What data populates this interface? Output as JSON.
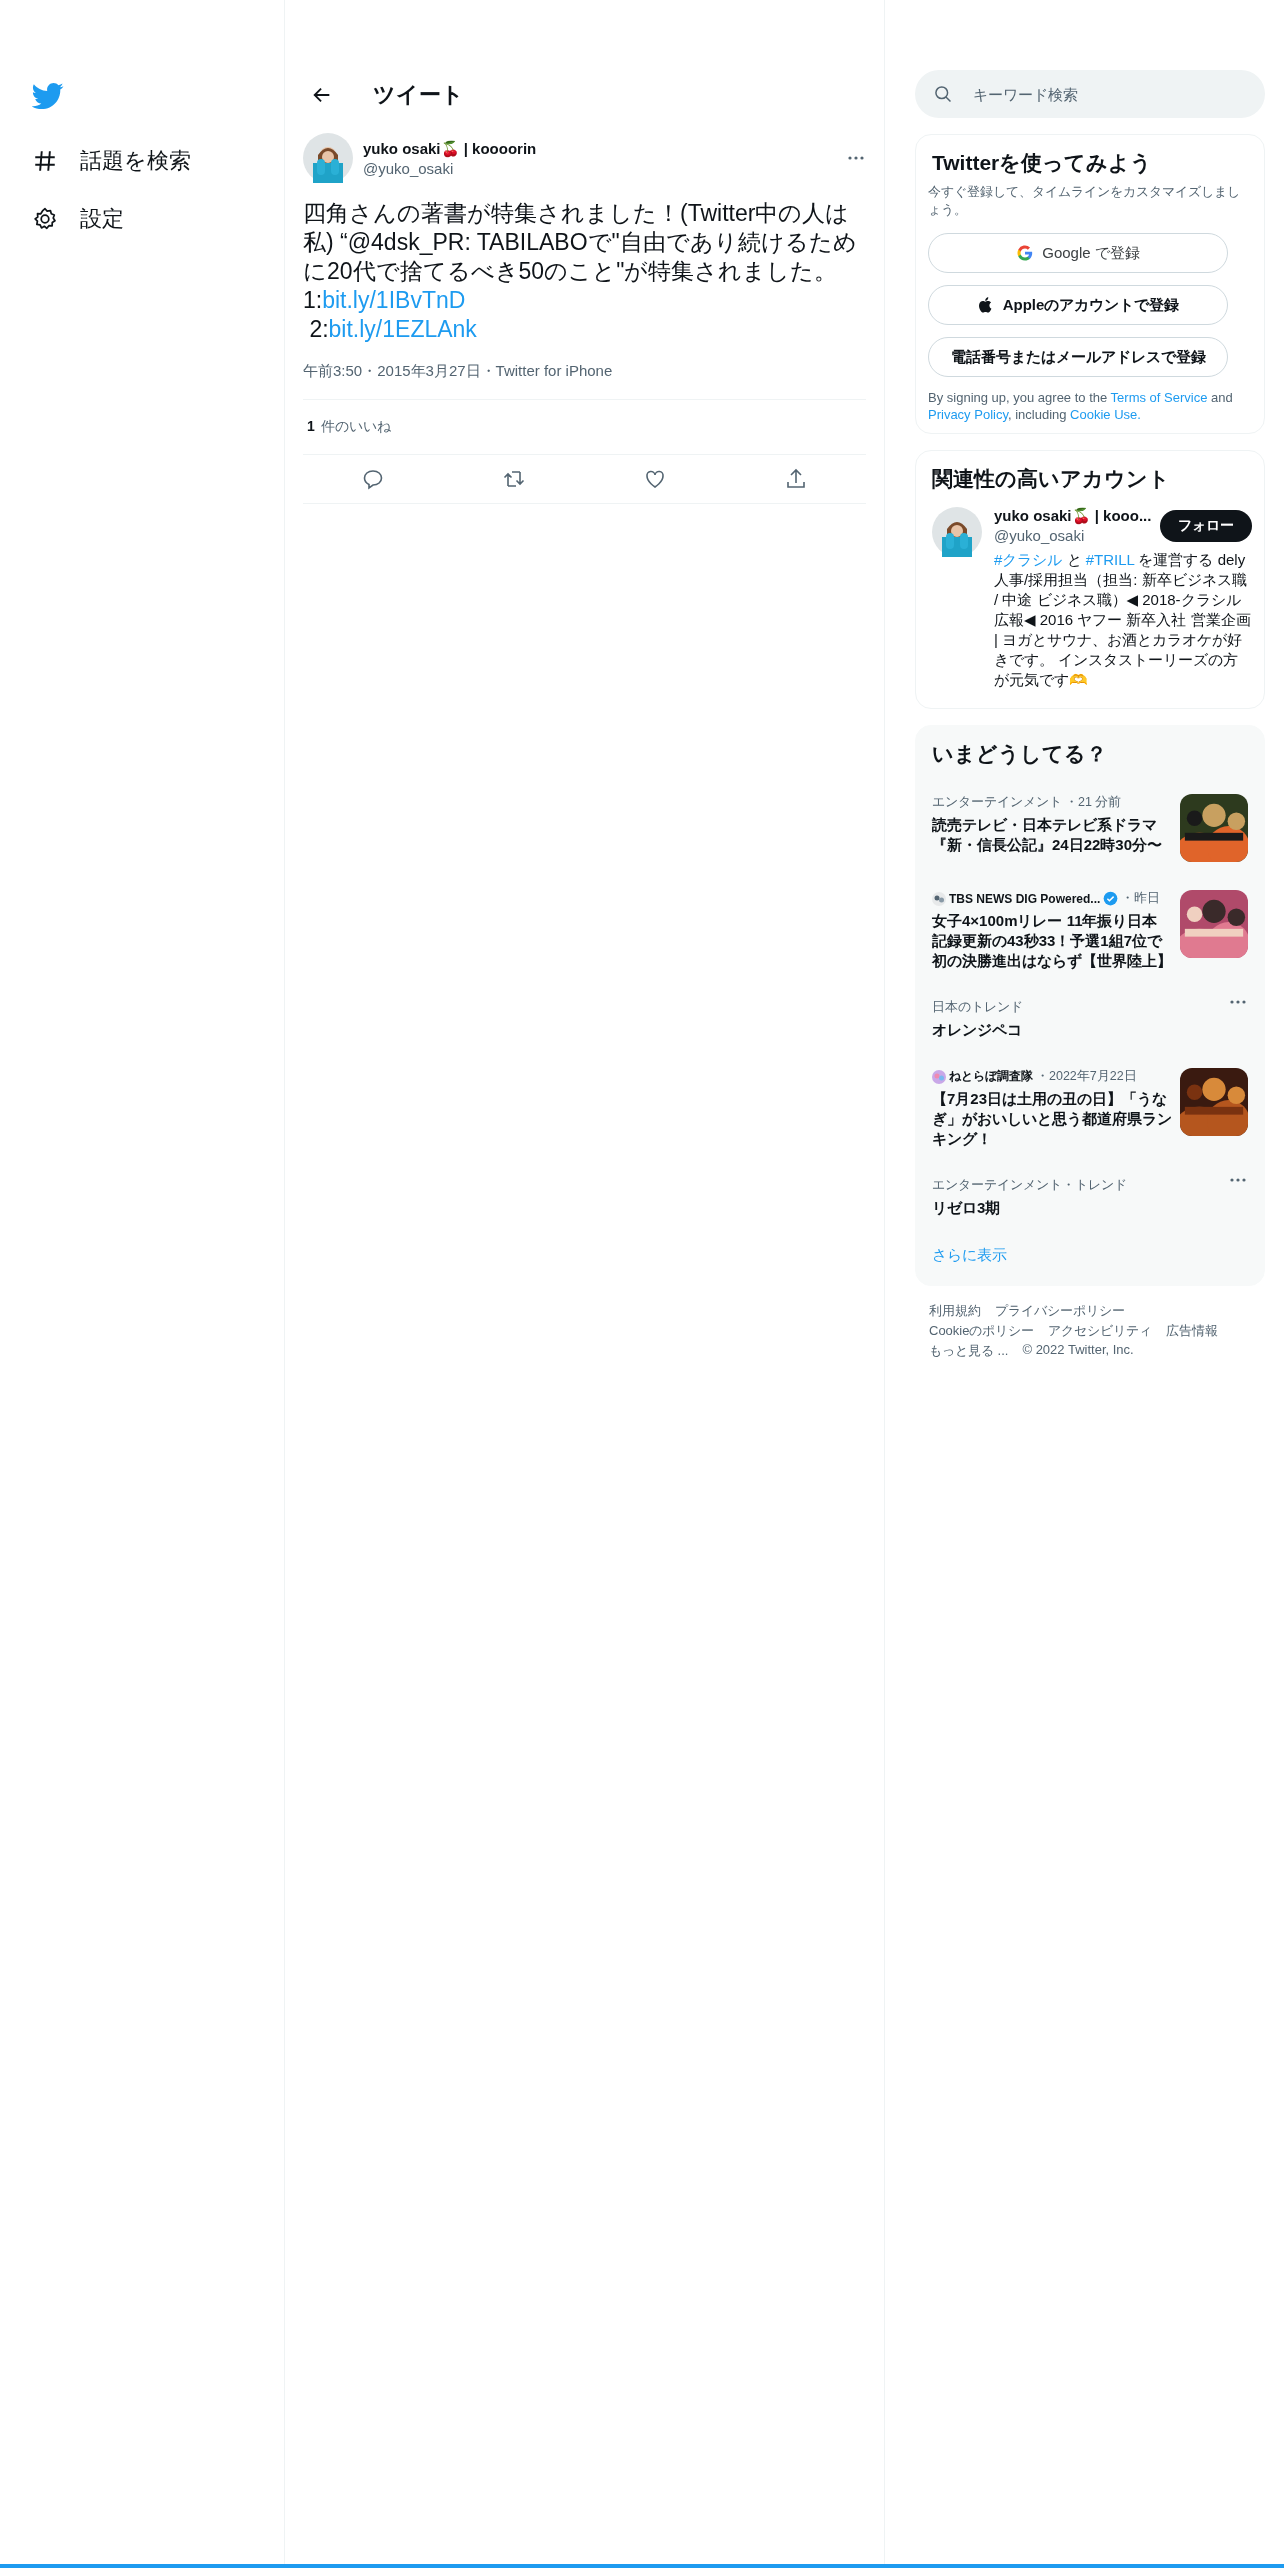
{
  "nav": {
    "items": [
      {
        "kind": "hash",
        "label": "話題を検索"
      },
      {
        "kind": "gear",
        "label": "設定"
      }
    ]
  },
  "header": {
    "title": "ツイート"
  },
  "tweet": {
    "name": "yuko osaki🍒 | koooorin",
    "handle": "@yuko_osaki",
    "text": "四角さんの著書が特集されました！(Twitter中の人は私) “@4dsk_PR: TABILABOで\"自由であり続けるために20代で捨てるべき50のこと\"が特集されました。",
    "links": [
      {
        "prefix": "1:",
        "url": "bit.ly/1IBvTnD"
      },
      {
        "prefix": " 2:",
        "url": "bit.ly/1EZLAnk"
      }
    ],
    "meta": "午前3:50・2015年3月27日・Twitter for iPhone",
    "likes_count": "1",
    "likes_label": "件のいいね"
  },
  "search": {
    "placeholder": "キーワード検索"
  },
  "signup": {
    "title": "Twitterを使ってみよう",
    "subtitle": "今すぐ登録して、タイムラインをカスタマイズしましょう。",
    "buttons": [
      {
        "kind": "google",
        "label": "Google で登録"
      },
      {
        "kind": "apple",
        "label": "Appleのアカウントで登録"
      },
      {
        "kind": "plain",
        "label": "電話番号またはメールアドレスで登録"
      }
    ],
    "legal": [
      {
        "kind": "plain",
        "text": "By signing up, you agree to the "
      },
      {
        "kind": "link",
        "text": "Terms of Service"
      },
      {
        "kind": "plain",
        "text": " and "
      },
      {
        "kind": "link",
        "text": "Privacy Policy"
      },
      {
        "kind": "plain",
        "text": ", including "
      },
      {
        "kind": "link",
        "text": "Cookie Use."
      }
    ]
  },
  "related": {
    "title": "関連性の高いアカウント",
    "name": "yuko osaki🍒 | kooo...",
    "handle": "@yuko_osaki",
    "follow": "フォロー",
    "bio": [
      {
        "kind": "hashtag",
        "text": "#クラシル"
      },
      {
        "kind": "plain",
        "text": " と "
      },
      {
        "kind": "hashtag",
        "text": "#TRILL"
      },
      {
        "kind": "plain",
        "text": " を運営する dely 人事/採用担当（担当: 新卒ビジネス職 / 中途 ビジネス職）◀ 2018-クラシル広報◀ 2016 ヤフー 新卒入社 営業企画 | ヨガとサウナ、お酒とカラオケが好きです。 インスタストーリーズの方が元気です🫶"
      }
    ]
  },
  "trends": {
    "title": "いまどうしてる？",
    "more": "さらに表示",
    "items": [
      {
        "kind": "news",
        "source_icon": false,
        "verified": false,
        "source": "エンターテインメント",
        "time": "・21 分前",
        "headline": "読売テレビ・日本テレビ系ドラマ『新・信長公記』24日22時30分〜"
      },
      {
        "kind": "news",
        "source_icon": true,
        "verified": true,
        "source": "TBS NEWS DIG Powered...",
        "time": "・昨日",
        "headline": "女子4×100mリレー 11年振り日本記録更新の43秒33！予選1組7位で初の決勝進出はならず【世界陸上】"
      },
      {
        "kind": "trend",
        "category": "日本のトレンド",
        "title": "オレンジペコ"
      },
      {
        "kind": "news",
        "source_icon": true,
        "verified": false,
        "source": "ねとらぼ調査隊",
        "time": "・2022年7月22日",
        "headline": "【7月23日は土用の丑の日】「うなぎ」がおいしいと思う都道府県ランキング！"
      },
      {
        "kind": "trend",
        "category": "エンターテインメント・トレンド",
        "title": "リゼロ3期"
      }
    ]
  },
  "footer": {
    "links": [
      "利用規約",
      "プライバシーポリシー",
      "Cookieのポリシー",
      "アクセシビリティ",
      "広告情報",
      "もっと見る ..."
    ],
    "copyright": "© 2022 Twitter, Inc."
  }
}
